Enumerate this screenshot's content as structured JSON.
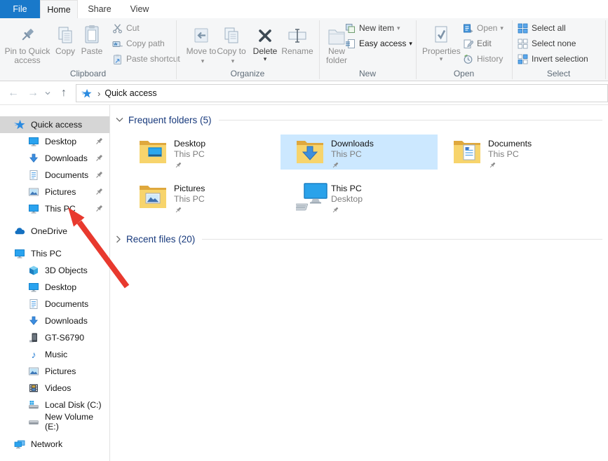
{
  "tabs": {
    "file": "File",
    "home": "Home",
    "share": "Share",
    "view": "View"
  },
  "ribbon": {
    "clipboard": {
      "group": "Clipboard",
      "pin": "Pin to Quick access",
      "copy": "Copy",
      "paste": "Paste",
      "cut": "Cut",
      "copy_path": "Copy path",
      "paste_shortcut": "Paste shortcut"
    },
    "organize": {
      "group": "Organize",
      "move_to": "Move to",
      "copy_to": "Copy to",
      "del": "Delete",
      "rename": "Rename"
    },
    "new_group": {
      "group": "New",
      "new_folder": "New folder",
      "new_item": "New item",
      "easy_access": "Easy access"
    },
    "open_group": {
      "group": "Open",
      "properties": "Properties",
      "open": "Open",
      "edit": "Edit",
      "history": "History"
    },
    "select_group": {
      "group": "Select",
      "select_all": "Select all",
      "select_none": "Select none",
      "invert_selection": "Invert selection"
    }
  },
  "addressbar": {
    "breadcrumb_root": "Quick access"
  },
  "sidebar": {
    "quick_access": "Quick access",
    "quick_items": [
      "Desktop",
      "Downloads",
      "Documents",
      "Pictures",
      "This PC"
    ],
    "onedrive": "OneDrive",
    "this_pc": "This PC",
    "pc_items": [
      "3D Objects",
      "Desktop",
      "Documents",
      "Downloads",
      "GT-S6790",
      "Music",
      "Pictures",
      "Videos",
      "Local Disk (C:)",
      "New Volume (E:)"
    ],
    "network": "Network"
  },
  "content": {
    "frequent_header": "Frequent folders (5)",
    "recent_header": "Recent files (20)",
    "tiles": [
      {
        "title": "Desktop",
        "subtitle": "This PC"
      },
      {
        "title": "Downloads",
        "subtitle": "This PC"
      },
      {
        "title": "Documents",
        "subtitle": "This PC"
      },
      {
        "title": "Pictures",
        "subtitle": "This PC"
      },
      {
        "title": "This PC",
        "subtitle": "Desktop"
      }
    ]
  },
  "colors": {
    "file_tab_blue": "#1979ca",
    "tile_selected_blue": "#cce8ff",
    "sidebar_selected_grey": "#d6d6d6",
    "section_header_blue": "#17397c",
    "annotation_arrow_red": "#e8392e",
    "folder_front": "#f7d46c",
    "folder_back": "#dfa83d"
  }
}
